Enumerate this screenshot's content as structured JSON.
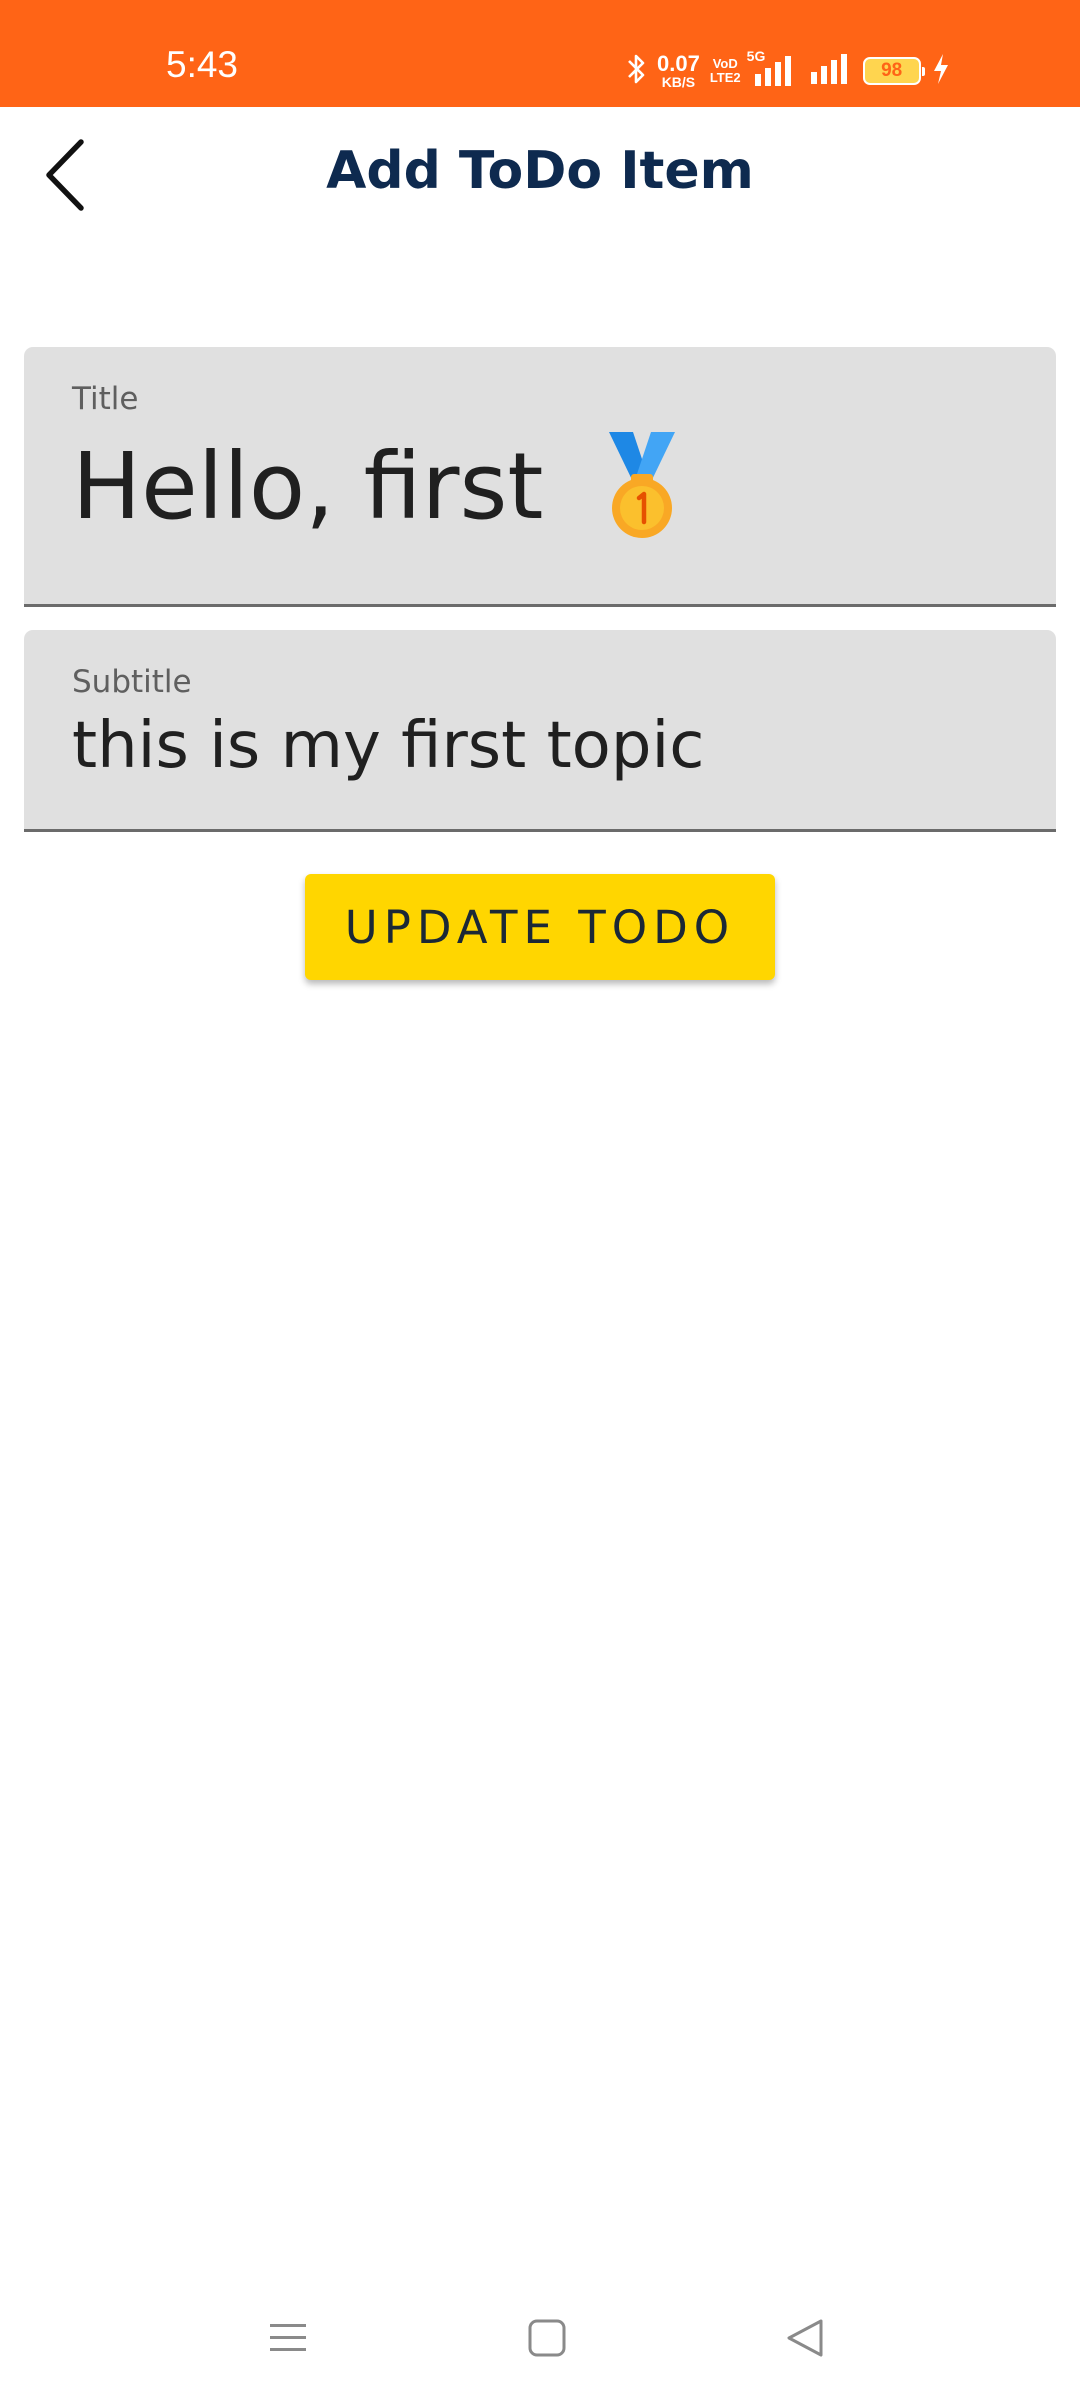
{
  "status_bar": {
    "time": "5:43",
    "net_speed_value": "0.07",
    "net_speed_unit": "KB/S",
    "volte_top": "VoD",
    "volte_bottom": "LTE2",
    "network_type": "5G",
    "battery_level": "98",
    "background_color": "#ff6416",
    "icons": [
      "bluetooth-icon",
      "signal-icon",
      "signal-icon",
      "charging-icon"
    ]
  },
  "app_bar": {
    "title": "Add ToDo Item",
    "back_icon": "chevron-left-icon"
  },
  "form": {
    "title_field": {
      "label": "Title",
      "value": "Hello, first",
      "emoji_icon": "first-place-medal-icon"
    },
    "subtitle_field": {
      "label": "Subtitle",
      "value": "this is my first topic"
    },
    "submit_button": {
      "label": "UPDATE TODO",
      "color": "#ffd600"
    }
  },
  "nav_bar": {
    "items": [
      "menu-icon",
      "home-icon",
      "back-icon"
    ]
  }
}
